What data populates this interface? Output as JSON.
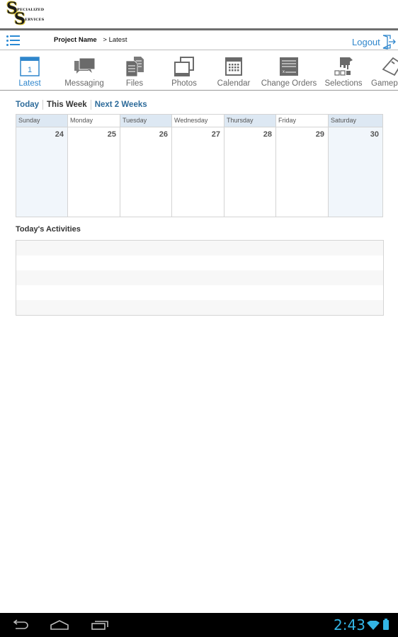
{
  "app": {
    "logo_line1": "PECIALIZED",
    "logo_line2": "ERVICES",
    "logo_letter": "S"
  },
  "breadcrumb": {
    "project": "Project Name",
    "separator": ">",
    "current": "Latest"
  },
  "header": {
    "menu_icon": "hamburger-list-icon",
    "logout_label": "Logout",
    "logout_icon": "logout-door-icon"
  },
  "tabs": [
    {
      "label": "Latest",
      "icon": "calendar-day-icon",
      "active": true,
      "badge": "1"
    },
    {
      "label": "Messaging",
      "icon": "chat-bubbles-icon",
      "active": false
    },
    {
      "label": "Files",
      "icon": "documents-icon",
      "active": false
    },
    {
      "label": "Photos",
      "icon": "photos-icon",
      "active": false
    },
    {
      "label": "Calendar",
      "icon": "calendar-grid-icon",
      "active": false
    },
    {
      "label": "Change Orders",
      "icon": "signature-form-icon",
      "active": false
    },
    {
      "label": "Selections",
      "icon": "hand-pointer-icon",
      "active": false
    },
    {
      "label": "Gamep",
      "icon": "whistle-icon",
      "active": false
    }
  ],
  "filters": [
    {
      "label": "Today",
      "current": false
    },
    {
      "label": "This Week",
      "current": true
    },
    {
      "label": "Next 2 Weeks",
      "current": false
    }
  ],
  "week": {
    "days": [
      {
        "name": "Sunday",
        "date": "24"
      },
      {
        "name": "Monday",
        "date": "25"
      },
      {
        "name": "Tuesday",
        "date": "26"
      },
      {
        "name": "Wednesday",
        "date": "27"
      },
      {
        "name": "Thursday",
        "date": "28"
      },
      {
        "name": "Friday",
        "date": "29"
      },
      {
        "name": "Saturday",
        "date": "30"
      }
    ]
  },
  "activities": {
    "title": "Today's Activities",
    "rows": [
      "",
      "",
      "",
      "",
      ""
    ]
  },
  "status_bar": {
    "time": "2:43",
    "wifi_icon": "wifi-icon",
    "battery_icon": "battery-icon"
  },
  "colors": {
    "accent": "#2f86cc",
    "filter_link": "#2d6b9a",
    "header_shade": "#dde8f3",
    "weekend_shade": "#f1f6fb",
    "status_accent": "#33b5e5"
  }
}
